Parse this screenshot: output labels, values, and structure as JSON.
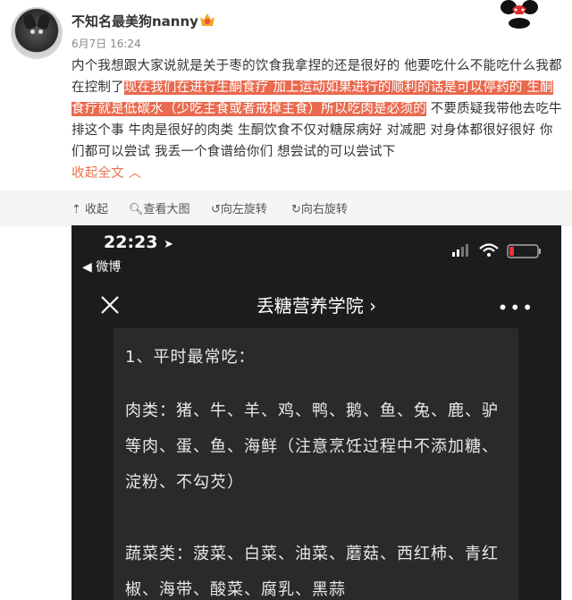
{
  "post": {
    "username": "不知名最美狗nanny",
    "date": "6月7日 16:24",
    "text_part1": "内个我想跟大家说就是关于枣的饮食我拿捏的还是很好的 他要吃什么不能吃什么我都在控制了",
    "text_highlight": "现在我们在进行生酮食疗 加上运动如果进行的顺利的话是可以停药的 生酮食疗就是低碳水（少吃主食或者戒掉主食）所以吃肉是必须的",
    "text_part2": "不要质疑我带他去吃牛排这个事 牛肉是很好的肉类 生酮饮食不仅对糖尿病好 对减肥 对身体都很好很好 你们都可以尝试 我丢一个食谱给你们 想尝试的可以尝试下",
    "collapse_label": "收起全文",
    "highlight_color": "#ea6a4f"
  },
  "toolbar": {
    "collapse": "收起",
    "view_large": "查看大图",
    "rotate_left": "向左旋转",
    "rotate_right": "向右旋转"
  },
  "screenshot": {
    "time": "22:23",
    "back_label": "◀ 微博",
    "title": "丢糖营养学院 ›",
    "more": "•••",
    "section1": "1、平时最常吃：",
    "meat": "肉类：猪、牛、羊、鸡、鸭、鹅、鱼、兔、鹿、驴等肉、蛋、鱼、海鲜（注意烹饪过程中不添加糖、淀粉、不勾芡）",
    "veg": "蔬菜类：菠菜、白菜、油菜、蘑菇、西红柿、青红椒、海带、酸菜、腐乳、黑蒜"
  }
}
